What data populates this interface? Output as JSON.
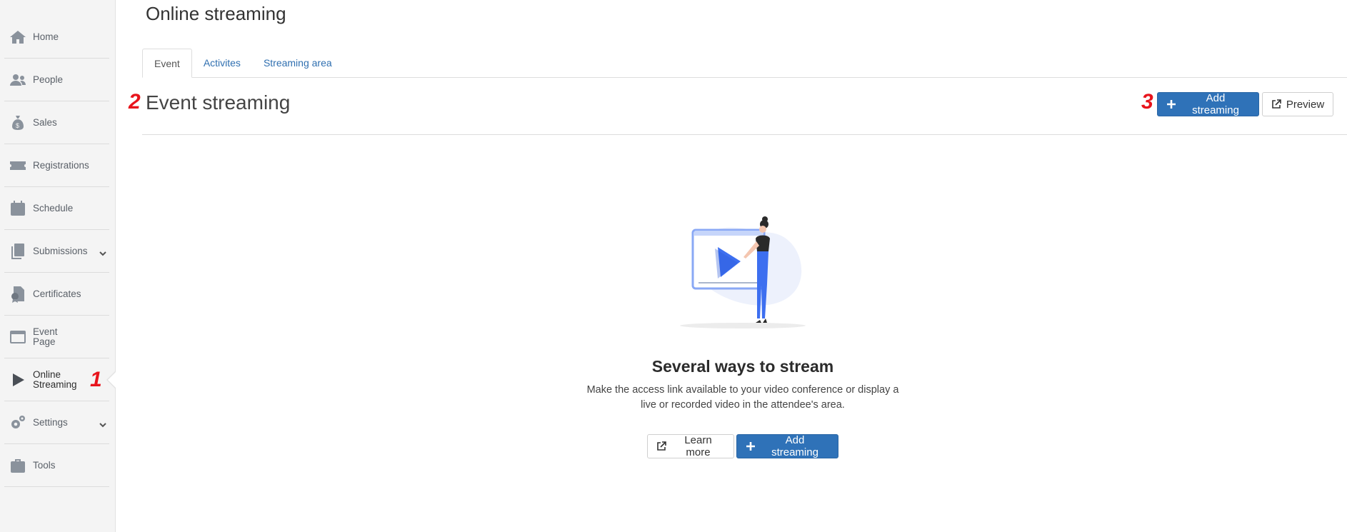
{
  "sidebar": {
    "items": [
      {
        "label": "Home",
        "icon": "home-icon"
      },
      {
        "label": "People",
        "icon": "people-icon"
      },
      {
        "label": "Sales",
        "icon": "money-bag-icon"
      },
      {
        "label": "Registrations",
        "icon": "ticket-icon"
      },
      {
        "label": "Schedule",
        "icon": "calendar-icon"
      },
      {
        "label": "Submissions",
        "icon": "documents-icon",
        "expandable": true
      },
      {
        "label": "Certificates",
        "icon": "certificate-icon"
      },
      {
        "label": "Event\nPage",
        "line1": "Event",
        "line2": "Page",
        "icon": "browser-window-icon"
      },
      {
        "label": "Online\nStreaming",
        "line1": "Online",
        "line2": "Streaming",
        "icon": "play-icon",
        "active": true
      },
      {
        "label": "Settings",
        "icon": "gears-icon",
        "expandable": true
      },
      {
        "label": "Tools",
        "icon": "toolbox-icon"
      }
    ]
  },
  "annotations": {
    "one": "1",
    "two": "2",
    "three": "3",
    "color": "#e8141c"
  },
  "page": {
    "title": "Online streaming"
  },
  "tabs": [
    {
      "label": "Event",
      "active": true
    },
    {
      "label": "Activites",
      "active": false
    },
    {
      "label": "Streaming area",
      "active": false
    }
  ],
  "section": {
    "title": "Event streaming",
    "add_streaming_label": "Add streaming",
    "preview_label": "Preview"
  },
  "empty_state": {
    "title": "Several ways to stream",
    "description": "Make the access link available to your video conference or display a live or recorded video in the attendee's area.",
    "learn_more_label": "Learn more",
    "add_streaming_label": "Add streaming"
  },
  "colors": {
    "primary": "#2f72b8",
    "link": "#2f6fb0",
    "sidebar_bg": "#f4f4f4",
    "illustration_blue": "#3d6ff0"
  }
}
